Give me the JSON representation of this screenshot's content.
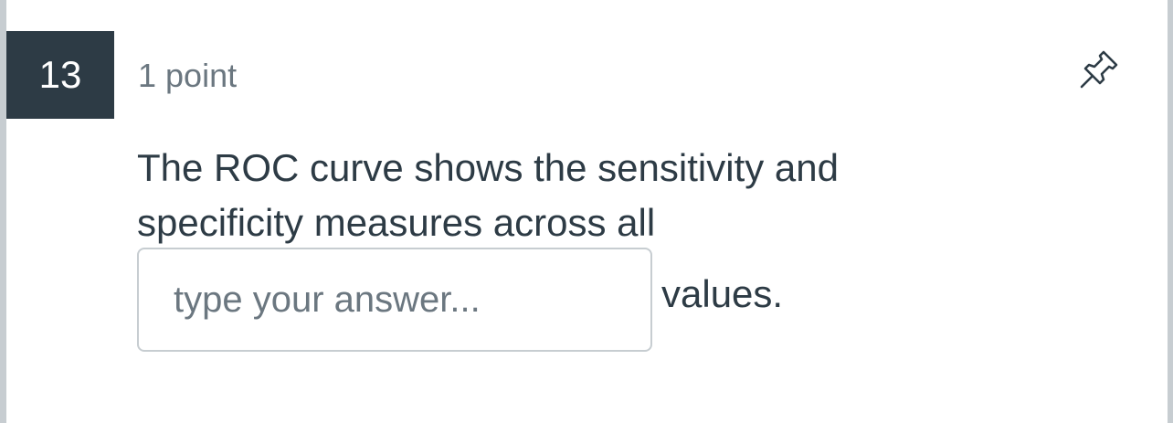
{
  "question": {
    "number": "13",
    "points": "1 point",
    "text_before": "The ROC curve shows the sensitivity and specificity measures across all",
    "text_after": "values."
  },
  "answer": {
    "placeholder": "type your answer...",
    "value": ""
  },
  "icons": {
    "pin": "pushpin-icon"
  }
}
